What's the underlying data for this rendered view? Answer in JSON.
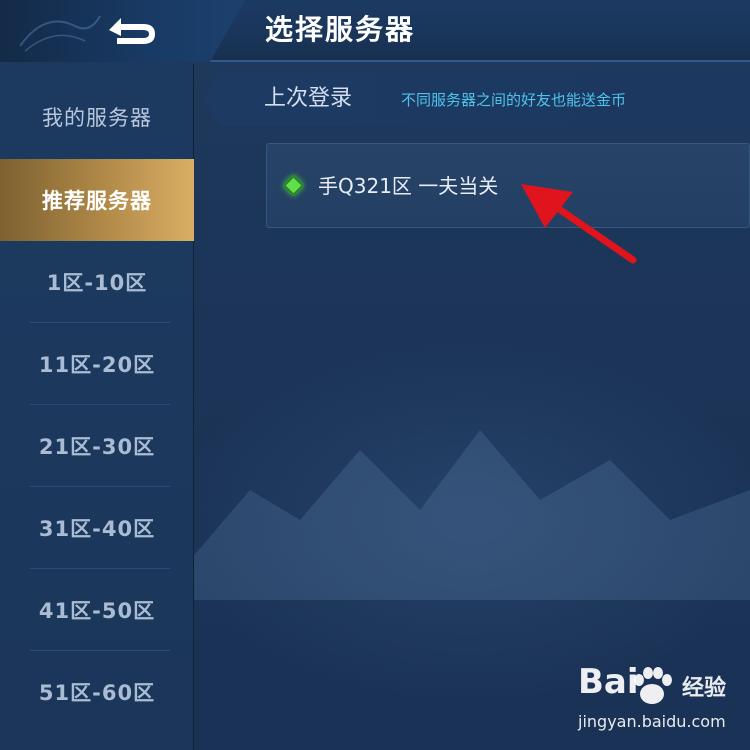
{
  "header": {
    "title": "选择服务器",
    "back_icon": "back-arrow-icon"
  },
  "sidebar": {
    "items": [
      {
        "label": "我的服务器",
        "active": false
      },
      {
        "label": "推荐服务器",
        "active": true
      },
      {
        "label": "1区-10区",
        "active": false
      },
      {
        "label": "11区-20区",
        "active": false
      },
      {
        "label": "21区-30区",
        "active": false
      },
      {
        "label": "31区-40区",
        "active": false
      },
      {
        "label": "41区-50区",
        "active": false
      },
      {
        "label": "51区-60区",
        "active": false
      }
    ]
  },
  "main": {
    "section_title": "上次登录",
    "section_hint": "不同服务器之间的好友也能送金币",
    "servers": [
      {
        "name": "手Q321区 一夫当关",
        "status_color": "#5fe04a",
        "status_icon": "diamond-status-icon"
      }
    ]
  },
  "annotation": {
    "arrow_color": "#e0141c"
  },
  "watermark": {
    "logo_text": "Bai",
    "brand": "经验",
    "url": "jingyan.baidu.com"
  },
  "colors": {
    "active_tab": "#b28a49",
    "hint_text": "#4fc3ea",
    "background": "#1c3658"
  }
}
